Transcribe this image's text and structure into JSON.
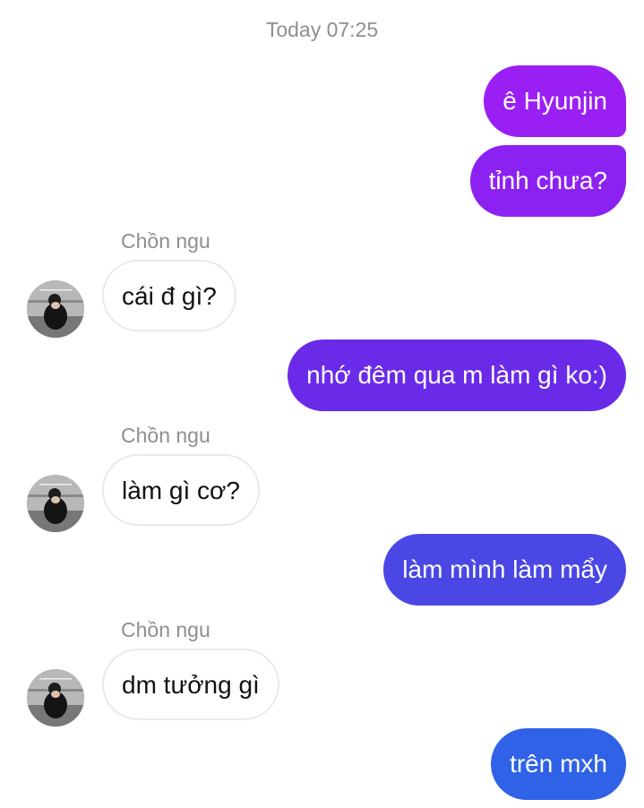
{
  "header": {
    "timestamp": "Today 07:25"
  },
  "messages": [
    {
      "side": "out",
      "text": "ê Hyunjin"
    },
    {
      "side": "out",
      "text": "tỉnh chưa?"
    },
    {
      "side": "in",
      "sender": "Chồn ngu",
      "text": "cái đ gì?"
    },
    {
      "side": "out",
      "text": "nhớ đêm qua m làm gì ko:)"
    },
    {
      "side": "in",
      "sender": "Chồn ngu",
      "text": "làm gì cơ?"
    },
    {
      "side": "out",
      "text": "làm mình làm mẩy"
    },
    {
      "side": "in",
      "sender": "Chồn ngu",
      "text": "dm tưởng gì"
    },
    {
      "side": "out",
      "text": "trên mxh"
    }
  ],
  "colors": {
    "outgoing_gradient": [
      "#9a1ff3",
      "#8c22f1",
      "#6a2be9",
      "#4a47e5",
      "#2f62e6"
    ],
    "incoming_border": "#e9e9ec",
    "meta_text": "#8e8e93"
  },
  "icons": {
    "avatar": "contact-avatar-photo"
  }
}
